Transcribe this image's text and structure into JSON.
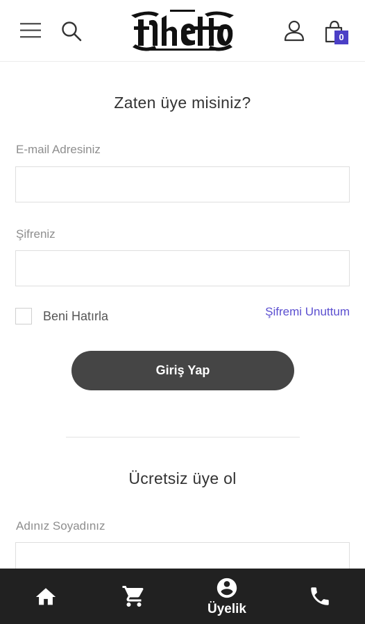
{
  "header": {
    "logo_alt": "Ghetto",
    "cart_count": "0",
    "icons": [
      "menu-icon",
      "search-icon",
      "user-icon",
      "shopping-bag-icon"
    ]
  },
  "login": {
    "title": "Zaten üye misiniz?",
    "email_label": "E-mail Adresiniz",
    "email_value": "",
    "password_label": "Şifreniz",
    "password_value": "",
    "remember_label": "Beni Hatırla",
    "remember_checked": false,
    "forgot_label": "Şifremi Unuttum",
    "submit_label": "Giriş Yap"
  },
  "register": {
    "title": "Ücretsiz üye ol",
    "name_label": "Adınız Soyadınız",
    "name_value": ""
  },
  "bottom_nav": {
    "items": [
      {
        "icon": "home-icon",
        "label": ""
      },
      {
        "icon": "cart-icon",
        "label": ""
      },
      {
        "icon": "account-icon",
        "label": "Üyelik"
      },
      {
        "icon": "phone-icon",
        "label": ""
      }
    ]
  },
  "colors": {
    "accent": "#5b4fd0",
    "badge": "#4b3fc6",
    "button": "#454545",
    "nav_bg": "#212121"
  }
}
